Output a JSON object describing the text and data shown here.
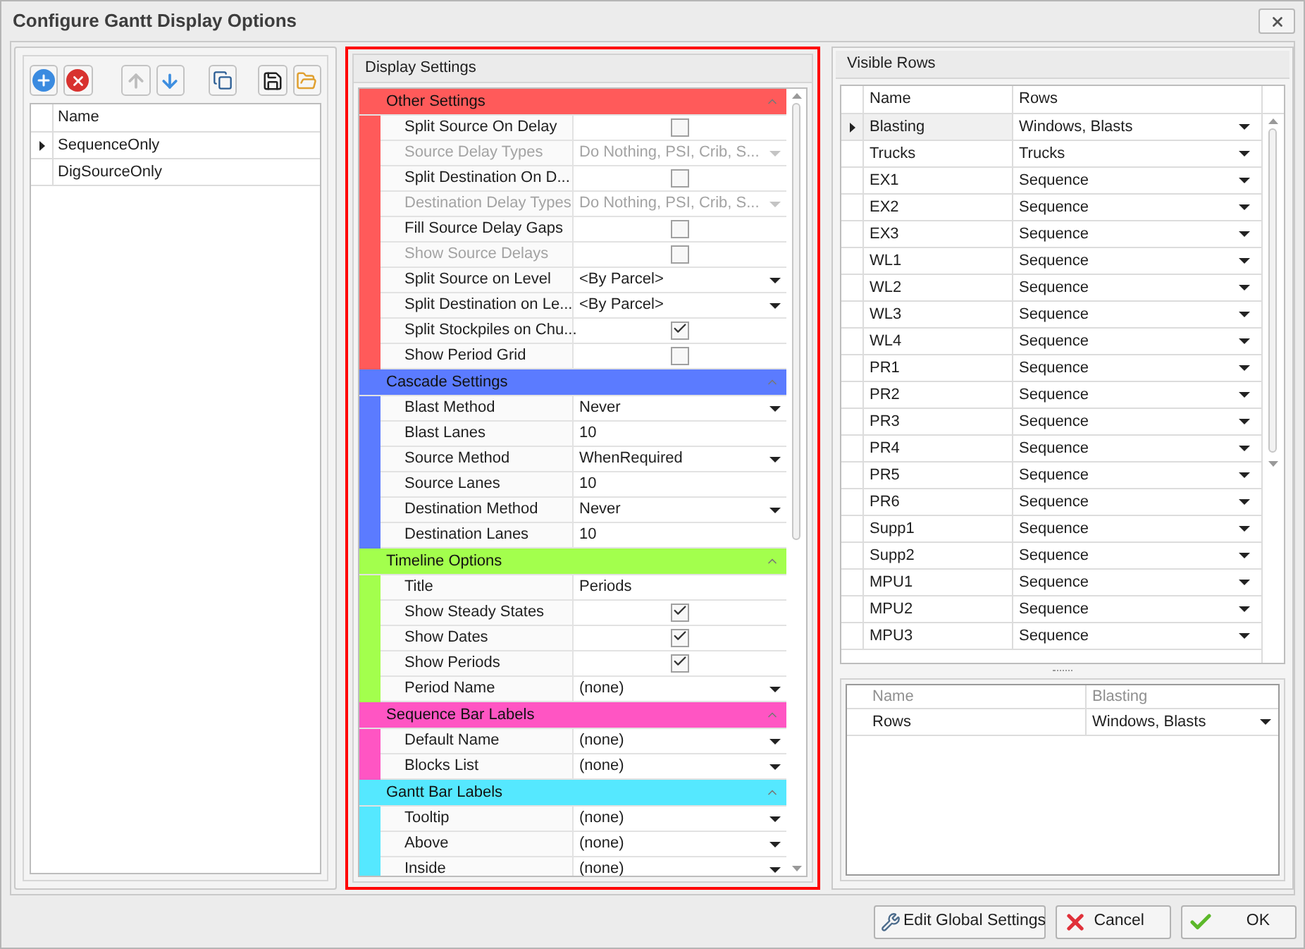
{
  "window": {
    "title": "Configure Gantt Display Options"
  },
  "profiles": {
    "columns": [
      "Name"
    ],
    "rows": [
      {
        "name": "SequenceOnly",
        "selected": true
      },
      {
        "name": "DigSourceOnly",
        "selected": false
      }
    ]
  },
  "display_settings": {
    "title": "Display Settings",
    "categories": [
      {
        "name": "Other Settings",
        "color": "#ff5a5a",
        "expanded": true,
        "properties": [
          {
            "name": "Split Source On Delay",
            "kind": "check",
            "checked": false,
            "disabled": false
          },
          {
            "name": "Source Delay Types",
            "kind": "dropdown",
            "value": "Do Nothing, PSI, Crib, S...",
            "disabled": true
          },
          {
            "name": "Split Destination On D...",
            "kind": "check",
            "checked": false,
            "disabled": false
          },
          {
            "name": "Destination Delay Types",
            "kind": "dropdown",
            "value": "Do Nothing, PSI, Crib, S...",
            "disabled": true
          },
          {
            "name": "Fill Source Delay Gaps",
            "kind": "check",
            "checked": false,
            "disabled": false
          },
          {
            "name": "Show Source Delays",
            "kind": "check",
            "checked": false,
            "disabled": true
          },
          {
            "name": "Split Source on Level",
            "kind": "dropdown",
            "value": "<By Parcel>",
            "disabled": false
          },
          {
            "name": "Split Destination on Le...",
            "kind": "dropdown",
            "value": "<By Parcel>",
            "disabled": false
          },
          {
            "name": "Split Stockpiles on Chu...",
            "kind": "check",
            "checked": true,
            "disabled": false
          },
          {
            "name": "Show Period Grid",
            "kind": "check",
            "checked": false,
            "disabled": false
          }
        ]
      },
      {
        "name": "Cascade Settings",
        "color": "#5b7bff",
        "expanded": true,
        "properties": [
          {
            "name": "Blast Method",
            "kind": "dropdown",
            "value": "Never",
            "disabled": false
          },
          {
            "name": "Blast Lanes",
            "kind": "text",
            "value": "10",
            "disabled": false
          },
          {
            "name": "Source Method",
            "kind": "dropdown",
            "value": "WhenRequired",
            "disabled": false
          },
          {
            "name": "Source Lanes",
            "kind": "text",
            "value": "10",
            "disabled": false
          },
          {
            "name": "Destination Method",
            "kind": "dropdown",
            "value": "Never",
            "disabled": false
          },
          {
            "name": "Destination Lanes",
            "kind": "text",
            "value": "10",
            "disabled": false
          }
        ]
      },
      {
        "name": "Timeline Options",
        "color": "#a3ff4d",
        "expanded": true,
        "properties": [
          {
            "name": "Title",
            "kind": "text",
            "value": "Periods",
            "disabled": false
          },
          {
            "name": "Show Steady States",
            "kind": "check",
            "checked": true,
            "disabled": false
          },
          {
            "name": "Show Dates",
            "kind": "check",
            "checked": true,
            "disabled": false
          },
          {
            "name": "Show Periods",
            "kind": "check",
            "checked": true,
            "disabled": false
          },
          {
            "name": "Period Name",
            "kind": "dropdown",
            "value": "(none)",
            "disabled": false
          }
        ]
      },
      {
        "name": "Sequence Bar Labels",
        "color": "#ff55c3",
        "expanded": true,
        "properties": [
          {
            "name": "Default Name",
            "kind": "dropdown",
            "value": "(none)",
            "disabled": false
          },
          {
            "name": "Blocks List",
            "kind": "dropdown",
            "value": "(none)",
            "disabled": false
          }
        ]
      },
      {
        "name": "Gantt Bar Labels",
        "color": "#55e8ff",
        "expanded": true,
        "properties": [
          {
            "name": "Tooltip",
            "kind": "dropdown",
            "value": "(none)",
            "disabled": false
          },
          {
            "name": "Above",
            "kind": "dropdown",
            "value": "(none)",
            "disabled": false
          },
          {
            "name": "Inside",
            "kind": "dropdown",
            "value": "(none)",
            "disabled": false
          }
        ]
      }
    ]
  },
  "visible_rows": {
    "title": "Visible Rows",
    "columns": [
      "Name",
      "Rows"
    ],
    "rows": [
      {
        "name": "Blasting",
        "rows": "Windows, Blasts",
        "selected": true
      },
      {
        "name": "Trucks",
        "rows": "Trucks",
        "selected": false
      },
      {
        "name": "EX1",
        "rows": "Sequence",
        "selected": false
      },
      {
        "name": "EX2",
        "rows": "Sequence",
        "selected": false
      },
      {
        "name": "EX3",
        "rows": "Sequence",
        "selected": false
      },
      {
        "name": "WL1",
        "rows": "Sequence",
        "selected": false
      },
      {
        "name": "WL2",
        "rows": "Sequence",
        "selected": false
      },
      {
        "name": "WL3",
        "rows": "Sequence",
        "selected": false
      },
      {
        "name": "WL4",
        "rows": "Sequence",
        "selected": false
      },
      {
        "name": "PR1",
        "rows": "Sequence",
        "selected": false
      },
      {
        "name": "PR2",
        "rows": "Sequence",
        "selected": false
      },
      {
        "name": "PR3",
        "rows": "Sequence",
        "selected": false
      },
      {
        "name": "PR4",
        "rows": "Sequence",
        "selected": false
      },
      {
        "name": "PR5",
        "rows": "Sequence",
        "selected": false
      },
      {
        "name": "PR6",
        "rows": "Sequence",
        "selected": false
      },
      {
        "name": "Supp1",
        "rows": "Sequence",
        "selected": false
      },
      {
        "name": "Supp2",
        "rows": "Sequence",
        "selected": false
      },
      {
        "name": "MPU1",
        "rows": "Sequence",
        "selected": false
      },
      {
        "name": "MPU2",
        "rows": "Sequence",
        "selected": false
      },
      {
        "name": "MPU3",
        "rows": "Sequence",
        "selected": false
      }
    ]
  },
  "row_editor": {
    "columns": [
      "Name",
      "Blasting"
    ],
    "rows": [
      {
        "name": "Rows",
        "value": "Windows, Blasts"
      }
    ]
  },
  "buttons": [
    {
      "label": "Edit Global Settings",
      "kind": "settings"
    },
    {
      "label": "Cancel",
      "kind": "cancel"
    },
    {
      "label": "OK",
      "kind": "ok"
    }
  ]
}
